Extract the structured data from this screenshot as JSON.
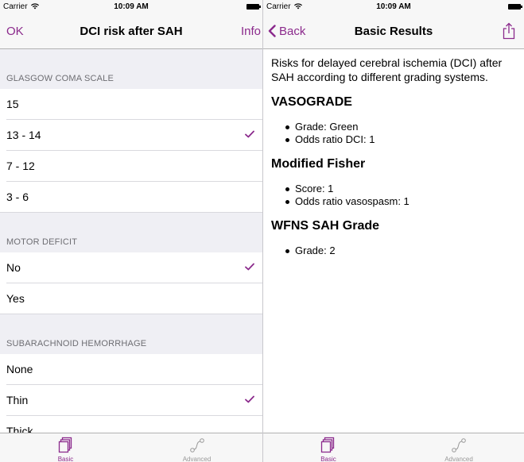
{
  "status": {
    "carrier": "Carrier",
    "time": "10:09 AM"
  },
  "left": {
    "nav": {
      "ok": "OK",
      "title": "DCI risk after SAH",
      "info": "Info"
    },
    "sections": [
      {
        "header": "GLASGOW COMA SCALE",
        "options": [
          {
            "label": "15",
            "checked": false
          },
          {
            "label": "13 - 14",
            "checked": true
          },
          {
            "label": "7 - 12",
            "checked": false
          },
          {
            "label": "3 - 6",
            "checked": false
          }
        ]
      },
      {
        "header": "MOTOR DEFICIT",
        "options": [
          {
            "label": "No",
            "checked": true
          },
          {
            "label": "Yes",
            "checked": false
          }
        ]
      },
      {
        "header": "SUBARACHNOID HEMORRHAGE",
        "options": [
          {
            "label": "None",
            "checked": false
          },
          {
            "label": "Thin",
            "checked": true
          },
          {
            "label": "Thick",
            "checked": false
          }
        ]
      }
    ]
  },
  "right": {
    "nav": {
      "back": "Back",
      "title": "Basic Results"
    },
    "intro": "Risks for delayed cerebral ischemia (DCI) after SAH according to different grading systems.",
    "groups": [
      {
        "title": "VASOGRADE",
        "items": [
          "Grade: Green",
          "Odds ratio DCI: 1"
        ]
      },
      {
        "title": "Modified Fisher",
        "items": [
          "Score: 1",
          "Odds ratio vasospasm: 1"
        ]
      },
      {
        "title": "WFNS SAH Grade",
        "items": [
          "Grade: 2"
        ]
      }
    ]
  },
  "tabs": [
    {
      "label": "Basic",
      "icon": "basic-icon",
      "active": true
    },
    {
      "label": "Advanced",
      "icon": "advanced-icon",
      "active": false
    }
  ],
  "colors": {
    "accent": "#8b2a8c",
    "inactive": "#999999",
    "group_bg": "#efeff4"
  }
}
